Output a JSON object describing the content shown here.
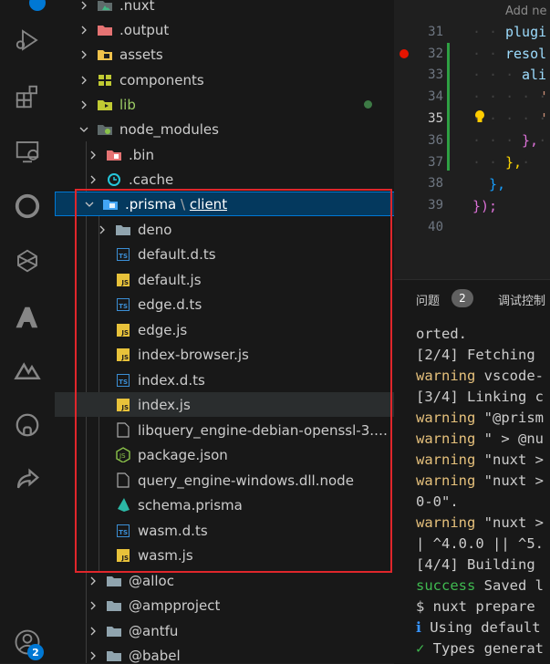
{
  "activity_bar": {
    "top_badge": "",
    "accounts_badge": "2",
    "icons": [
      "run-debug-icon",
      "extensions-icon",
      "remote-explorer-icon",
      "circle-extension-icon",
      "prisma-alt-icon",
      "azure-icon",
      "nuxt-icon",
      "github-icon",
      "share-icon",
      "account-icon"
    ]
  },
  "explorer": {
    "items": [
      {
        "label": ".nuxt",
        "kind": "folder",
        "icon": "nuxt-folder-icon"
      },
      {
        "label": ".output",
        "kind": "folder",
        "icon": "output-folder-icon"
      },
      {
        "label": "assets",
        "kind": "folder",
        "icon": "assets-folder-icon"
      },
      {
        "label": "components",
        "kind": "folder",
        "icon": "components-folder-icon"
      },
      {
        "label": "lib",
        "kind": "folder",
        "icon": "lib-folder-icon"
      },
      {
        "label": "node_modules",
        "kind": "folder-open",
        "icon": "node-modules-folder-icon"
      },
      {
        "label": ".bin",
        "kind": "folder",
        "icon": "bin-folder-icon"
      },
      {
        "label": ".cache",
        "kind": "folder",
        "icon": "cache-folder-icon"
      },
      {
        "label_a": ".prisma",
        "label_sep": "\\",
        "label_b": "client",
        "kind": "folder-open-selected",
        "icon": "prisma-folder-icon"
      },
      {
        "label": "deno",
        "kind": "folder",
        "icon": "folder-icon"
      },
      {
        "label": "default.d.ts",
        "kind": "ts"
      },
      {
        "label": "default.js",
        "kind": "js"
      },
      {
        "label": "edge.d.ts",
        "kind": "ts"
      },
      {
        "label": "edge.js",
        "kind": "js"
      },
      {
        "label": "index-browser.js",
        "kind": "js"
      },
      {
        "label": "index.d.ts",
        "kind": "ts"
      },
      {
        "label": "index.js",
        "kind": "js"
      },
      {
        "label": "libquery_engine-debian-openssl-3.0....",
        "kind": "file"
      },
      {
        "label": "package.json",
        "kind": "json"
      },
      {
        "label": "query_engine-windows.dll.node",
        "kind": "file"
      },
      {
        "label": "schema.prisma",
        "kind": "prisma"
      },
      {
        "label": "wasm.d.ts",
        "kind": "ts"
      },
      {
        "label": "wasm.js",
        "kind": "js"
      },
      {
        "label": "@alloc",
        "kind": "folder"
      },
      {
        "label": "@ampproject",
        "kind": "folder"
      },
      {
        "label": "@antfu",
        "kind": "folder"
      },
      {
        "label": "@babel",
        "kind": "folder"
      }
    ]
  },
  "editor": {
    "hint": "Add ne",
    "lines": [
      {
        "num": "31",
        "text": "plugi"
      },
      {
        "num": "32",
        "text": "resol"
      },
      {
        "num": "33",
        "text": "ali"
      },
      {
        "num": "34",
        "text": "'"
      },
      {
        "num": "35",
        "text": "'"
      },
      {
        "num": "36",
        "text": "},"
      },
      {
        "num": "37",
        "text": "},"
      },
      {
        "num": "38",
        "text": "},"
      },
      {
        "num": "39",
        "text": "});"
      },
      {
        "num": "40",
        "text": ""
      }
    ]
  },
  "panel": {
    "tab_problems": "问题",
    "problems_count": "2",
    "tab_debug": "调试控制",
    "terminal_lines": [
      {
        "parts": [
          {
            "t": "orted.",
            "c": ""
          }
        ]
      },
      {
        "parts": [
          {
            "t": "[2/4] Fetching",
            "c": ""
          }
        ]
      },
      {
        "parts": [
          {
            "t": "warning",
            "c": "warn"
          },
          {
            "t": " vscode-",
            "c": ""
          }
        ]
      },
      {
        "parts": [
          {
            "t": "[3/4] Linking c",
            "c": ""
          }
        ]
      },
      {
        "parts": [
          {
            "t": "warning",
            "c": "warn"
          },
          {
            "t": " \"@prism",
            "c": ""
          }
        ]
      },
      {
        "parts": [
          {
            "t": "warning",
            "c": "warn"
          },
          {
            "t": " \" > @nu",
            "c": ""
          }
        ]
      },
      {
        "parts": [
          {
            "t": "warning",
            "c": "warn"
          },
          {
            "t": " \"nuxt >",
            "c": ""
          }
        ]
      },
      {
        "parts": [
          {
            "t": "warning",
            "c": "warn"
          },
          {
            "t": " \"nuxt >",
            "c": ""
          }
        ]
      },
      {
        "parts": [
          {
            "t": "0-0\".",
            "c": ""
          }
        ]
      },
      {
        "parts": [
          {
            "t": "warning",
            "c": "warn"
          },
          {
            "t": " \"nuxt >",
            "c": ""
          }
        ]
      },
      {
        "parts": [
          {
            "t": "| ^4.0.0 || ^5.",
            "c": ""
          }
        ]
      },
      {
        "parts": [
          {
            "t": "[4/4] Building",
            "c": ""
          }
        ]
      },
      {
        "parts": [
          {
            "t": "success",
            "c": "succ"
          },
          {
            "t": " Saved l",
            "c": ""
          }
        ]
      },
      {
        "parts": [
          {
            "t": "$ nuxt prepare",
            "c": ""
          }
        ]
      },
      {
        "parts": [
          {
            "t": "ℹ",
            "c": "info"
          },
          {
            "t": " Using default",
            "c": ""
          }
        ]
      },
      {
        "parts": [
          {
            "t": "✓",
            "c": "succ"
          },
          {
            "t": " Types generat",
            "c": ""
          }
        ]
      }
    ]
  },
  "colors": {
    "accent": "#0078d4",
    "highlight_box": "#e0262b",
    "warning": "#e5c07b",
    "success": "#3fb950"
  }
}
